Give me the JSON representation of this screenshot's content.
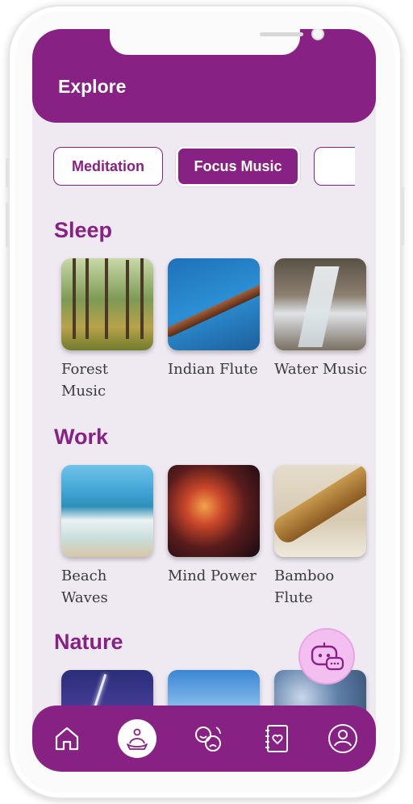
{
  "header": {
    "title": "Explore"
  },
  "tabs": [
    {
      "label": "Meditation",
      "active": false
    },
    {
      "label": "Focus Music",
      "active": true
    },
    {
      "label": "",
      "active": false
    }
  ],
  "sections": [
    {
      "title": "Sleep",
      "items": [
        {
          "label": "Forest Music",
          "image": "forest"
        },
        {
          "label": "Indian Flute",
          "image": "flute"
        },
        {
          "label": "Water Music",
          "image": "waterfall"
        }
      ]
    },
    {
      "title": "Work",
      "items": [
        {
          "label": "Beach Waves",
          "image": "beach"
        },
        {
          "label": "Mind Power",
          "image": "nebula"
        },
        {
          "label": "Bamboo Flute",
          "image": "bamboo"
        }
      ]
    },
    {
      "title": "Nature",
      "items": [
        {
          "label": "",
          "image": "lightning"
        },
        {
          "label": "",
          "image": "sky"
        },
        {
          "label": "",
          "image": "glitter"
        }
      ]
    }
  ],
  "assistant": {
    "icon": "chatbot-icon"
  },
  "bottom_nav": [
    {
      "icon": "home-icon",
      "active": false
    },
    {
      "icon": "meditation-icon",
      "active": true
    },
    {
      "icon": "mood-icon",
      "active": false
    },
    {
      "icon": "journal-icon",
      "active": false
    },
    {
      "icon": "profile-icon",
      "active": false
    }
  ],
  "colors": {
    "brand": "#882184",
    "background": "#efeaf2",
    "fab": "#f3bff0"
  }
}
